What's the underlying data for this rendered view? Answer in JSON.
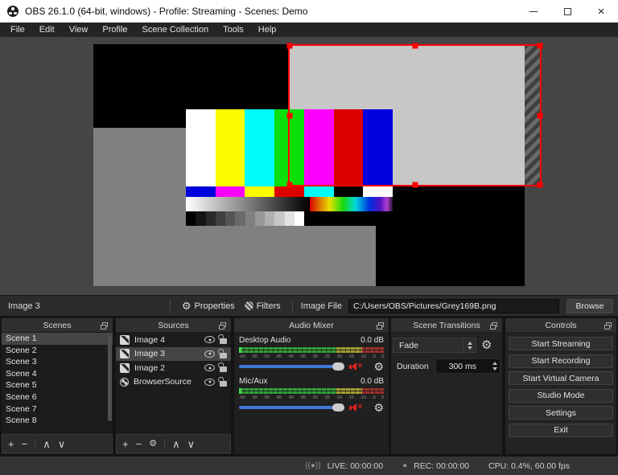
{
  "window": {
    "title": "OBS 26.1.0 (64-bit, windows) - Profile: Streaming - Scenes: Demo"
  },
  "menu": {
    "items": [
      "File",
      "Edit",
      "View",
      "Profile",
      "Scene Collection",
      "Tools",
      "Help"
    ]
  },
  "source_toolbar": {
    "selected_source": "Image 3",
    "properties_label": "Properties",
    "filters_label": "Filters",
    "image_file_label": "Image File",
    "image_file_path": "C:/Users/OBS/Pictures/Grey169B.png",
    "browse_label": "Browse"
  },
  "panels": {
    "scenes": {
      "title": "Scenes",
      "items": [
        "Scene 1",
        "Scene 2",
        "Scene 3",
        "Scene 4",
        "Scene 5",
        "Scene 6",
        "Scene 7",
        "Scene 8"
      ],
      "selected_index": 0
    },
    "sources": {
      "title": "Sources",
      "items": [
        {
          "name": "Image 4",
          "icon": "image",
          "selected": false
        },
        {
          "name": "Image 3",
          "icon": "image",
          "selected": true
        },
        {
          "name": "Image 2",
          "icon": "image",
          "selected": false
        },
        {
          "name": "BrowserSource",
          "icon": "globe",
          "selected": false
        }
      ]
    },
    "audio_mixer": {
      "title": "Audio Mixer",
      "channels": [
        {
          "name": "Desktop Audio",
          "level": "0.0 dB"
        },
        {
          "name": "Mic/Aux",
          "level": "0.0 dB"
        }
      ],
      "scale_ticks": [
        "-60",
        "-55",
        "-50",
        "-45",
        "-40",
        "-35",
        "-30",
        "-25",
        "-20",
        "-15",
        "-10",
        "-5",
        "0"
      ]
    },
    "scene_transitions": {
      "title": "Scene Transitions",
      "transition_value": "Fade",
      "duration_label": "Duration",
      "duration_value": "300 ms"
    },
    "controls": {
      "title": "Controls",
      "buttons": [
        "Start Streaming",
        "Start Recording",
        "Start Virtual Camera",
        "Studio Mode",
        "Settings",
        "Exit"
      ]
    }
  },
  "status_bar": {
    "live_label": "LIVE: 00:00:00",
    "rec_label": "REC: 00:00:00",
    "cpu_label": "CPU: 0.4%, 60.00 fps"
  },
  "colors": {
    "canvas_bg": "#454545",
    "preview_bg": "#000000",
    "gray_source": "#808080",
    "selected_source_fill": "#c7c7c7",
    "stripe_dark": "#3f3f3f",
    "stripe_light": "#6a6a6a",
    "selection_red": "#ff0000",
    "meter_green": "#36a03a",
    "meter_yellow": "#a89f33",
    "meter_red": "#9e332e",
    "meter_peak": "#3fe04a",
    "slider_blue": "#3e78d4"
  },
  "preview_content": {
    "main_bars": [
      "#ffffff",
      "#fbfb00",
      "#00fbfb",
      "#0be00b",
      "#fb00fb",
      "#dc0000",
      "#0000dc"
    ],
    "small_bars": [
      "#0000dc",
      "#fb00fb",
      "#fbfb00",
      "#dc0000",
      "#00fbfb",
      "#000000",
      "#ffffff"
    ],
    "gray_steps": [
      "#000000",
      "#151515",
      "#2a2a2a",
      "#3f3f3f",
      "#555555",
      "#6a6a6a",
      "#808080",
      "#989898",
      "#b0b0b0",
      "#c8c8c8",
      "#e2e2e2",
      "#ffffff"
    ]
  }
}
